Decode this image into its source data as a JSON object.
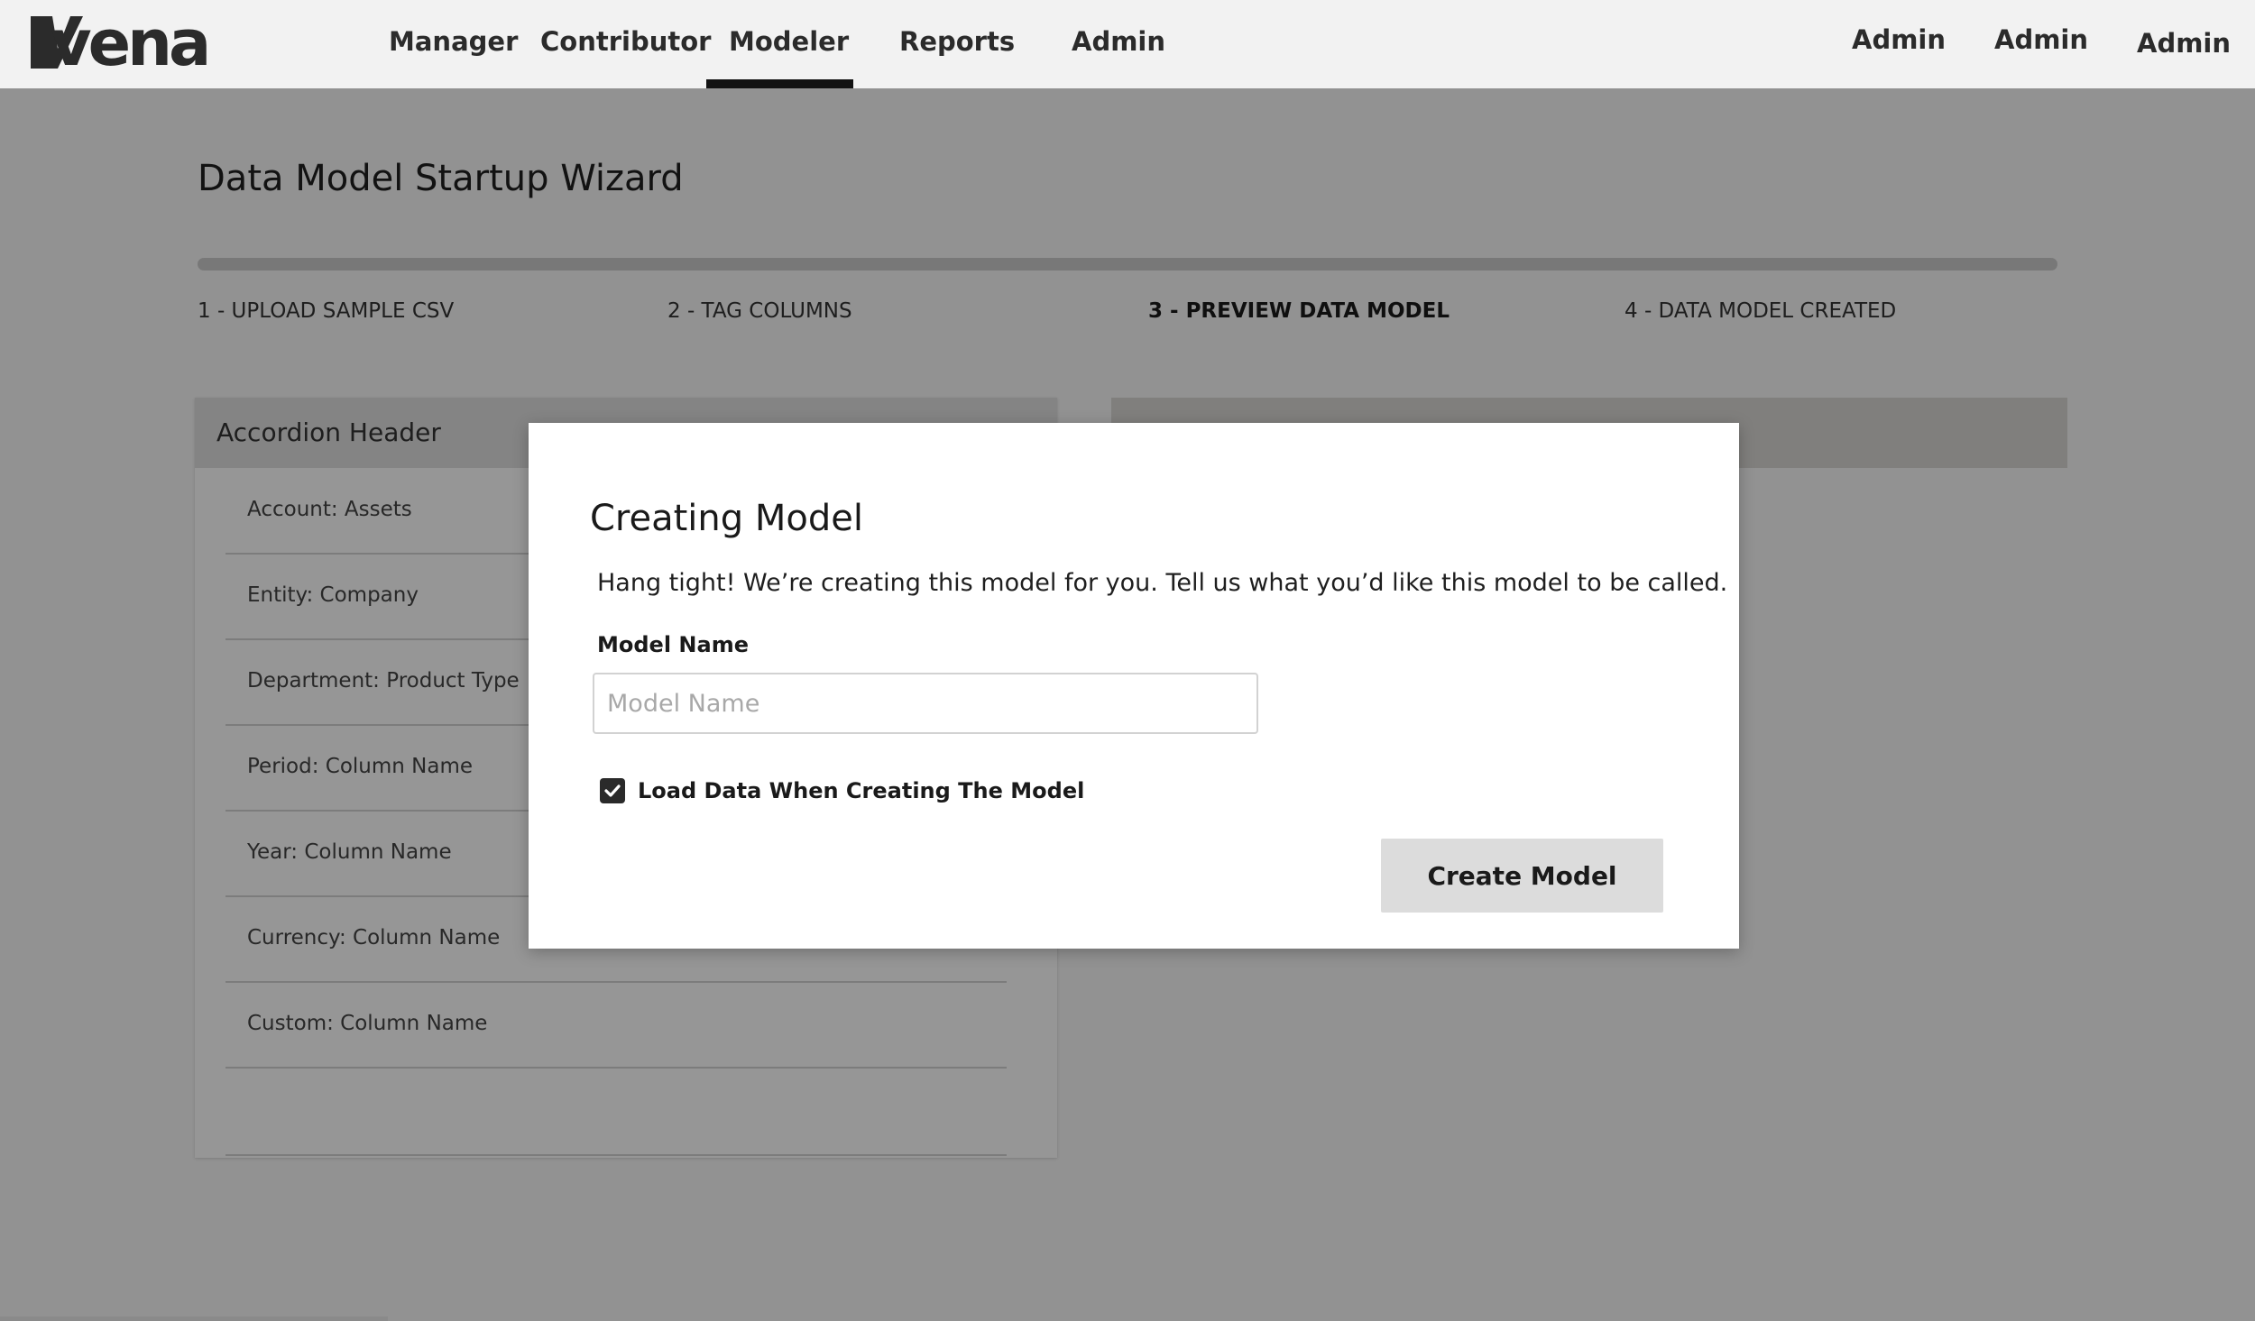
{
  "brand": {
    "logo_text": "vena"
  },
  "nav": {
    "items": [
      {
        "label": "Manager"
      },
      {
        "label": "Contributor"
      },
      {
        "label": "Modeler"
      },
      {
        "label": "Reports"
      },
      {
        "label": "Admin"
      }
    ],
    "active": "Modeler",
    "right_items": [
      {
        "label": "Admin"
      },
      {
        "label": "Admin"
      },
      {
        "label": "Admin"
      }
    ]
  },
  "wizard": {
    "title": "Data Model Startup Wizard",
    "steps": [
      {
        "label": "1 - UPLOAD SAMPLE CSV"
      },
      {
        "label": "2 - TAG COLUMNS"
      },
      {
        "label": "3 - PREVIEW DATA MODEL"
      },
      {
        "label": "4 - DATA MODEL CREATED"
      }
    ],
    "active_step": 3
  },
  "accordion": {
    "header": "Accordion Header",
    "rows": [
      {
        "label": "Account: Assets"
      },
      {
        "label": "Entity: Company"
      },
      {
        "label": "Department: Product Type"
      },
      {
        "label": "Period: Column Name"
      },
      {
        "label": "Year: Column Name"
      },
      {
        "label": "Currency: Column Name"
      },
      {
        "label": "Custom: Column Name"
      }
    ]
  },
  "modal": {
    "title": "Creating Model",
    "description": "Hang tight! We’re creating this model for you. Tell us what you’d like this model to be called.",
    "field_label": "Model Name",
    "input_value": "",
    "input_placeholder": "Model Name",
    "checkbox_label": "Load Data When Creating The Model",
    "checkbox_checked": true,
    "create_button": "Create Model"
  },
  "icons": {
    "checkbox": "check-icon"
  }
}
